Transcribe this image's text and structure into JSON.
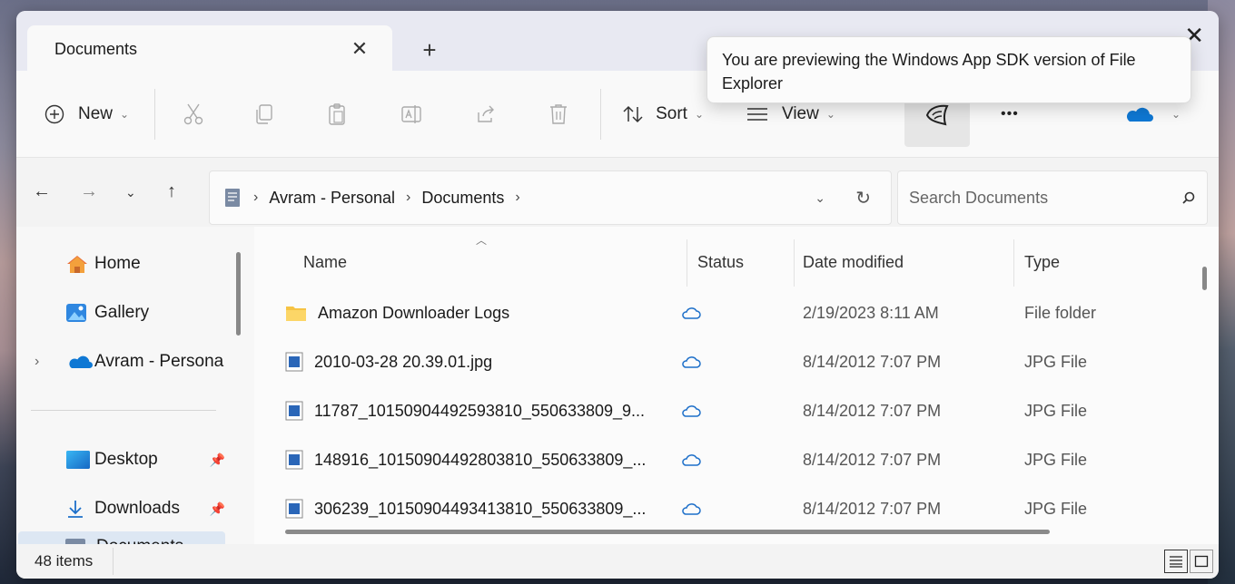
{
  "tab": {
    "title": "Documents",
    "close": "✕",
    "new": "+"
  },
  "window": {
    "close": "✕"
  },
  "tooltip": {
    "text": "You are previewing the Windows App SDK version of File Explorer"
  },
  "toolbar": {
    "new_label": "New",
    "sort_label": "Sort",
    "view_label": "View",
    "more_label": "•••",
    "icons": [
      "cut-icon",
      "copy-icon",
      "paste-icon",
      "rename-icon",
      "share-icon",
      "delete-icon"
    ]
  },
  "address": {
    "crumbs": [
      "Avram - Personal",
      "Documents"
    ],
    "separator": "›"
  },
  "search": {
    "placeholder": "Search Documents"
  },
  "sidebar": {
    "items": [
      {
        "label": "Home",
        "icon": "home-icon"
      },
      {
        "label": "Gallery",
        "icon": "gallery-icon"
      },
      {
        "label": "Avram - Persona",
        "icon": "onedrive-icon"
      },
      {
        "label": "Desktop",
        "icon": "desktop-icon",
        "pinned": true
      },
      {
        "label": "Downloads",
        "icon": "downloads-icon",
        "pinned": true
      },
      {
        "label": "Documents",
        "icon": "documents-icon",
        "pinned": true
      }
    ]
  },
  "columns": {
    "name": "Name",
    "status": "Status",
    "date": "Date modified",
    "type": "Type"
  },
  "files": [
    {
      "name": "Amazon Downloader Logs",
      "kind": "folder",
      "date": "2/19/2023 8:11 AM",
      "type": "File folder"
    },
    {
      "name": "2010-03-28 20.39.01.jpg",
      "kind": "image",
      "date": "8/14/2012 7:07 PM",
      "type": "JPG File"
    },
    {
      "name": "11787_10150904492593810_550633809_9...",
      "kind": "image",
      "date": "8/14/2012 7:07 PM",
      "type": "JPG File"
    },
    {
      "name": "148916_10150904492803810_550633809_...",
      "kind": "image",
      "date": "8/14/2012 7:07 PM",
      "type": "JPG File"
    },
    {
      "name": "306239_10150904493413810_550633809_...",
      "kind": "image",
      "date": "8/14/2012 7:07 PM",
      "type": "JPG File"
    }
  ],
  "status": {
    "item_count": "48 items"
  },
  "colors": {
    "accent": "#0a67c6",
    "onedrive": "#0f78d4",
    "folder": "#f6c343"
  }
}
